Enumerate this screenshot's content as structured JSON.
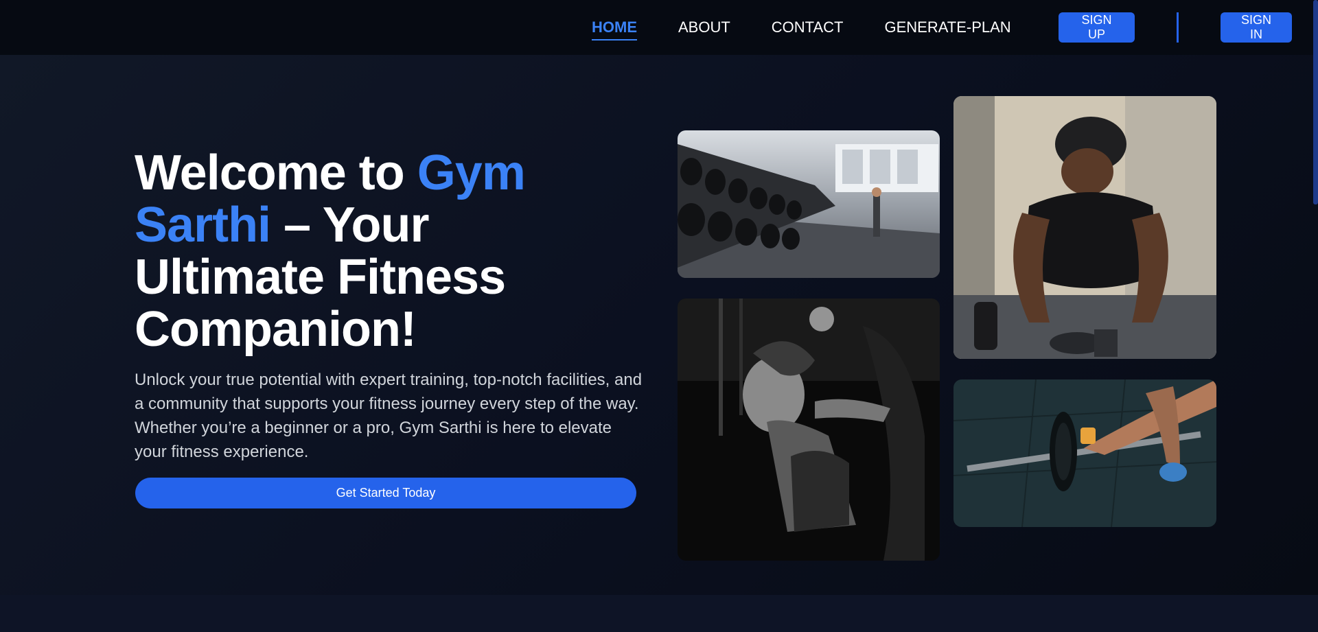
{
  "nav": {
    "links": [
      {
        "label": "HOME",
        "active": true
      },
      {
        "label": "ABOUT",
        "active": false
      },
      {
        "label": "CONTACT",
        "active": false
      },
      {
        "label": "GENERATE-PLAN",
        "active": false
      }
    ],
    "signup_label": "SIGN UP",
    "signin_label": "SIGN IN"
  },
  "hero": {
    "title_part1": "Welcome to ",
    "title_accent": "Gym Sarthi",
    "title_part2": " – Your Ultimate Fitness Companion!",
    "description": "Unlock your true potential with expert training, top-notch facilities, and a community that supports your fitness journey every step of the way. Whether you’re a beginner or a pro, Gym Sarthi is here to elevate your fitness experience.",
    "cta_label": "Get Started Today"
  },
  "gallery": [
    {
      "icon": "dumbbell-rack-photo"
    },
    {
      "icon": "man-training-photo"
    },
    {
      "icon": "woman-squat-photo"
    },
    {
      "icon": "barbell-deadlift-photo"
    }
  ],
  "colors": {
    "accent": "#3b82f6",
    "button": "#2563eb",
    "background": "#0c1120",
    "navbar": "#060a12"
  }
}
